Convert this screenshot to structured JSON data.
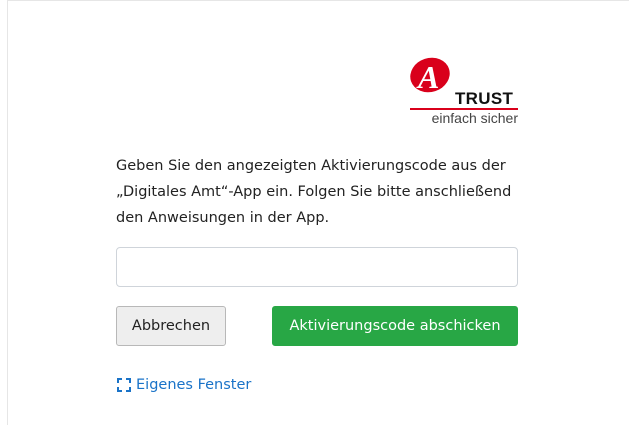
{
  "logo": {
    "letter": "A",
    "brand": "TRUST",
    "tagline": "einfach sicher",
    "accent_color": "#d9001b"
  },
  "instructions": "Geben Sie den angezeigten Aktivierungscode aus der „Digitales Amt“-App ein. Folgen Sie bitte anschließend den Anweisungen in der App.",
  "code_input": {
    "value": "",
    "placeholder": ""
  },
  "buttons": {
    "cancel_label": "Abbrechen",
    "submit_label": "Aktivierungscode abschicken",
    "submit_color": "#28a745"
  },
  "own_window": {
    "label": "Eigenes Fenster",
    "icon": "fullscreen-icon",
    "color": "#1a73c8"
  }
}
